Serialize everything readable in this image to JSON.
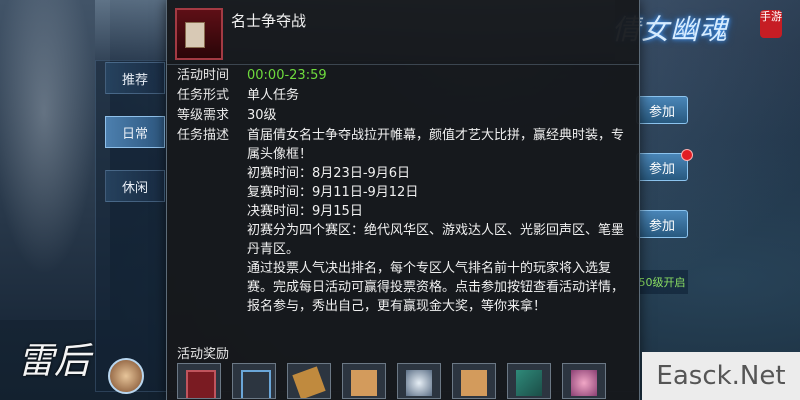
{
  "logo": {
    "title": "倩女幽魂",
    "sub": "手游"
  },
  "tabs": [
    {
      "label": "推荐"
    },
    {
      "label": "日常"
    },
    {
      "label": "休闲"
    }
  ],
  "right_buttons": [
    {
      "label": "参加"
    },
    {
      "label": "参加"
    },
    {
      "label": "参加"
    }
  ],
  "level_open": "50级开启",
  "bottom_title": "雷后",
  "popup": {
    "title": "名士争夺战",
    "fields": [
      {
        "label": "活动时间",
        "value": "00:00-23:59",
        "color": "#6edb3d"
      },
      {
        "label": "任务形式",
        "value": "单人任务"
      },
      {
        "label": "等级需求",
        "value": "30级"
      }
    ],
    "desc_label": "任务描述",
    "description": [
      "首届倩女名士争夺战拉开帷幕，颜值才艺大比拼，赢经典时装，专属头像框！",
      "初赛时间：8月23日-9月6日",
      "复赛时间：9月11日-9月12日",
      "决赛时间：9月15日",
      "初赛分为四个赛区：绝代风华区、游戏达人区、光影回声区、笔墨丹青区。",
      "通过投票人气决出排名，每个专区人气排名前十的玩家将入选复赛。完成每日活动可赢得投票资格。点击参加按钮查看活动详情，报名参与，秀出自己，更有赢现金大奖，等你来拿！"
    ],
    "reward_label": "活动奖励",
    "rewards": [
      {
        "icon": "avatar-frame-icon"
      },
      {
        "icon": "empty-frame-icon"
      },
      {
        "icon": "scroll-icon"
      },
      {
        "icon": "scroll-icon"
      },
      {
        "icon": "character-icon"
      },
      {
        "icon": "scroll-icon"
      },
      {
        "icon": "fan-icon"
      },
      {
        "icon": "flower-icon"
      }
    ]
  },
  "watermark": "Easck.Net"
}
